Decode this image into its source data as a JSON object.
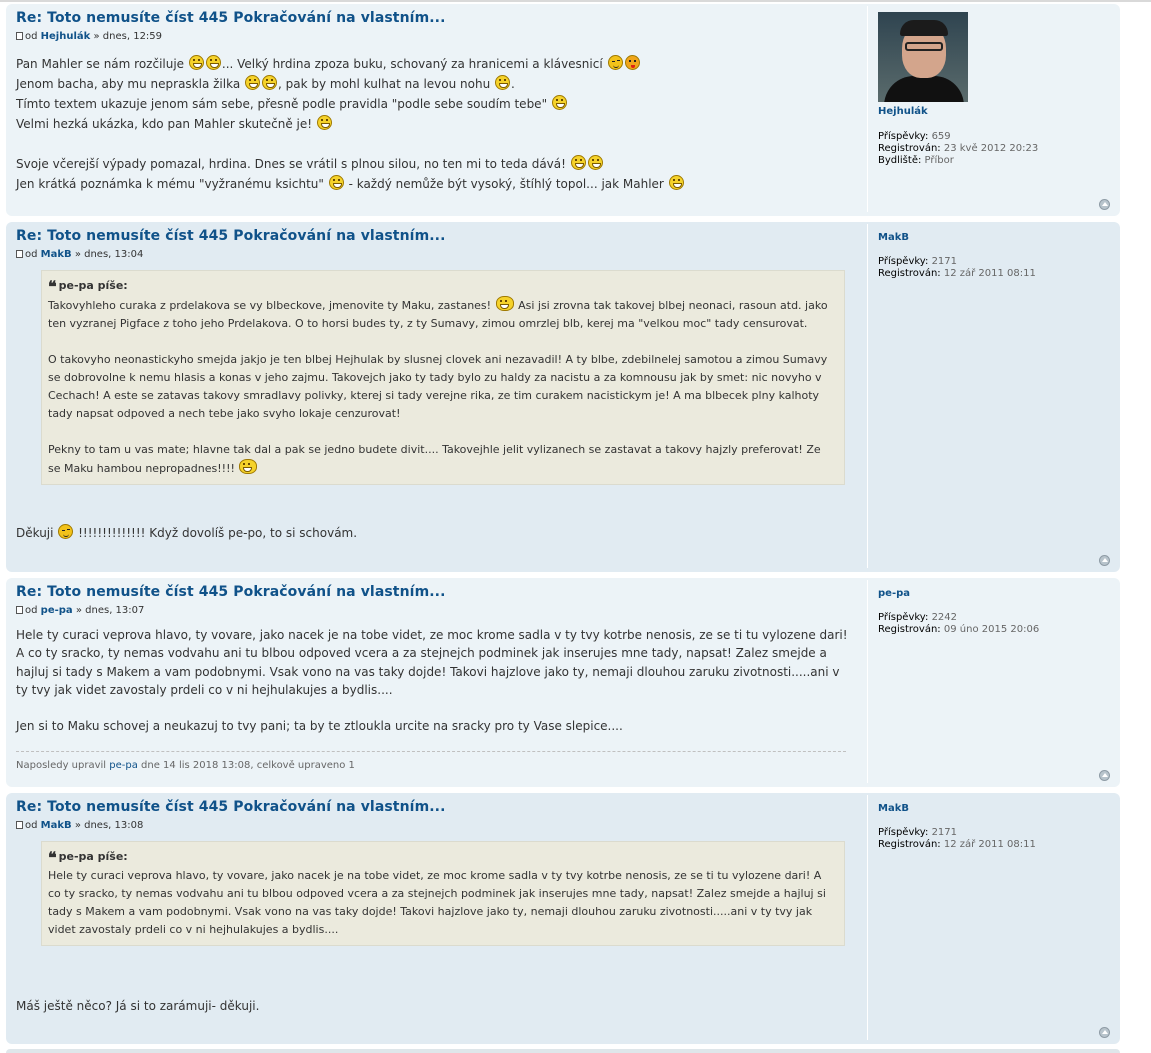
{
  "posts": [
    {
      "title": "Re: Toto nemusíte číst 445 Pokračování na vlastním...",
      "by": "od",
      "user": "Hejhulák",
      "time": "» dnes, 12:59",
      "profile": {
        "name": "Hejhulák",
        "posts_label": "Příspěvky:",
        "posts": "659",
        "registered_label": "Registrován:",
        "registered": "23 kvě 2012 20:23",
        "location_label": "Bydliště:",
        "location": "Příbor"
      },
      "lines": [
        [
          "Pan Mahler se nám rozčiluje ",
          "... Velký hrdina zpoza buku, schovaný za hranicemi a klávesnicí "
        ],
        [
          "Jenom bacha, aby mu nepraskla žilka ",
          ", pak by mohl kulhat na levou nohu ",
          "."
        ],
        [
          "Tímto textem ukazuje jenom sám sebe, přesně podle pravidla \"podle sebe soudím tebe\" "
        ],
        [
          "Velmi hezká ukázka, kdo pan Mahler skutečně je! "
        ],
        [
          "Svoje včerejší výpady pomazal, hrdina. Dnes se vrátil s plnou silou, no ten mi to teda dává! "
        ],
        [
          "Jen krátká poznámka k mému \"vyžranému ksichtu\" ",
          " - každý nemůže být vysoký, štíhlý topol... jak Mahler "
        ]
      ]
    },
    {
      "title": "Re: Toto nemusíte číst 445 Pokračování na vlastním...",
      "by": "od",
      "user": "MakB",
      "time": "» dnes, 13:04",
      "profile": {
        "name": "MakB",
        "posts_label": "Příspěvky:",
        "posts": "2171",
        "registered_label": "Registrován:",
        "registered": "12 zář 2011 08:11"
      },
      "quote_cite": "pe-pa píše:",
      "quote_p1": [
        "Takovyhleho curaka z prdelakova se vy blbeckove, jmenovite ty Maku, zastanes! ",
        " Asi jsi zrovna tak takovej blbej neonaci, rasoun atd. jako ten vyzranej Pigface z toho jeho Prdelakova. O to horsi budes ty, z ty Sumavy, zimou omrzlej blb, kerej ma \"velkou moc\" tady censurovat."
      ],
      "quote_p2": "O takovyho neonastickyho smejda jakjo je ten blbej Hejhulak by slusnej clovek ani nezavadil! A ty blbe, zdebilnelej samotou a zimou Sumavy se dobrovolne k nemu hlasis a konas v jeho zajmu. Takovejch jako ty tady bylo zu haldy za nacistu a za komnousu jak by smet: nic novyho v Cechach! A este se zatavas takovy smradlavy polivky, kterej si tady verejne rika, ze tim curakem nacistickym je! A ma blbecek plny kalhoty tady napsat odpoved a nech tebe jako svyho lokaje cenzurovat!",
      "quote_p3": "Pekny to tam u vas mate; hlavne tak dal a pak se jedno budete divit.... Takovejhle jelit vylizanech se zastavat a takovy hajzly preferovat! Ze se Maku hambou nepropadnes!!!! ",
      "reply": [
        "Děkuji ",
        " !!!!!!!!!!!!!! Když dovolíš pe-po, to si schovám."
      ]
    },
    {
      "title": "Re: Toto nemusíte číst 445 Pokračování na vlastním...",
      "by": "od",
      "user": "pe-pa",
      "time": "» dnes, 13:07",
      "profile": {
        "name": "pe-pa",
        "posts_label": "Příspěvky:",
        "posts": "2242",
        "registered_label": "Registrován:",
        "registered": "09 úno 2015 20:06"
      },
      "text1": "Hele ty curaci veprova hlavo, ty vovare, jako nacek je na tobe videt, ze moc krome sadla v ty tvy kotrbe nenosis, ze se ti tu vylozene dari! A co ty sracko, ty nemas vodvahu ani tu blbou odpoved vcera a za stejnejch podminek jak inserujes mne tady, napsat! Zalez smejde a hajluj si tady s Makem a vam podobnymi. Vsak vono na vas taky dojde! Takovi hajzlove jako ty, nemaji dlouhou zaruku zivotnosti.....ani v ty tvy jak videt zavostaly prdeli co v ni hejhulakujes a bydlis....",
      "text2": "Jen si to Maku schovej a neukazuj to tvy pani; ta by te ztloukla urcite na sracky pro ty Vase slepice....",
      "notice_prefix": "Naposledy upravil",
      "notice_user": "pe-pa",
      "notice_suffix": "dne 14 lis 2018 13:08, celkově upraveno 1"
    },
    {
      "title": "Re: Toto nemusíte číst 445 Pokračování na vlastním...",
      "by": "od",
      "user": "MakB",
      "time": "» dnes, 13:08",
      "profile": {
        "name": "MakB",
        "posts_label": "Příspěvky:",
        "posts": "2171",
        "registered_label": "Registrován:",
        "registered": "12 zář 2011 08:11"
      },
      "quote_cite": "pe-pa píše:",
      "quote_text": "Hele ty curaci veprova hlavo, ty vovare, jako nacek je na tobe videt, ze moc krome sadla v ty tvy kotrbe nenosis, ze se ti tu vylozene dari! A co ty sracko, ty nemas vodvahu ani tu blbou odpoved vcera a za stejnejch podminek jak inserujes mne tady, napsat! Zalez smejde a hajluj si tady s Makem a vam podobnymi. Vsak vono na vas taky dojde! Takovi hajzlove jako ty, nemaji dlouhou zaruku zivotnosti.....ani v ty tvy jak videt zavostaly prdeli co v ni hejhulakujes a bydlis....",
      "reply": "Máš ještě něco? Já si to zarámuji- děkuji."
    }
  ]
}
